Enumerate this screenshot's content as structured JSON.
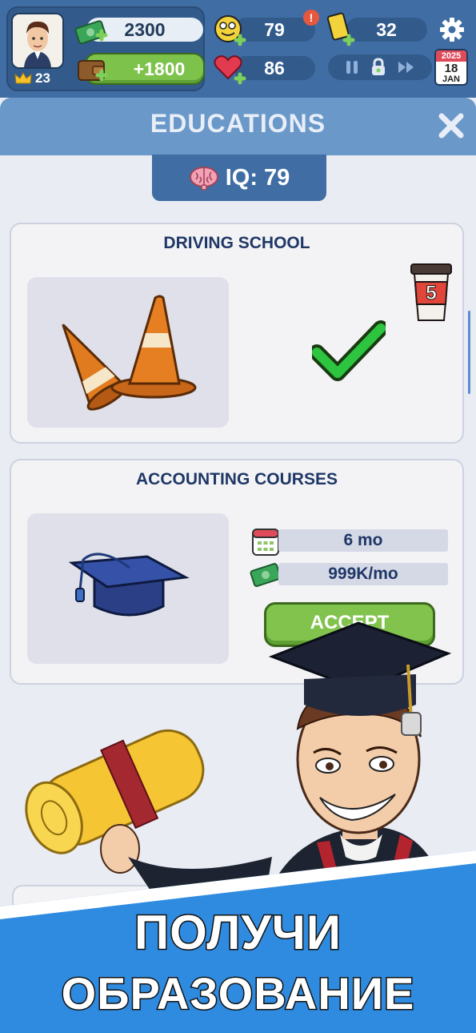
{
  "hud": {
    "level": "23",
    "money": "2300",
    "income": "+1800",
    "happiness": "79",
    "health": "86",
    "energy": "32",
    "calendar": {
      "year": "2025",
      "day": "18",
      "month": "JAN"
    },
    "alert": "!"
  },
  "panel": {
    "title": "EDUCATIONS",
    "iq": "IQ: 79"
  },
  "courses": [
    {
      "title": "DRIVING SCHOOL",
      "status": "completed",
      "badge": "5"
    },
    {
      "title": "ACCOUNTING COURSES",
      "duration": "6 mo",
      "cost": "999K/mo",
      "action": "ACCEPT"
    }
  ],
  "promo": {
    "line1": "ПОЛУЧИ",
    "line2": "ОБРАЗОВАНИЕ"
  },
  "colors": {
    "hud_bg": "#3f6da4",
    "panel_head": "#6a98c9",
    "accept_green": "#82c34e",
    "banner_blue": "#2f8be0",
    "title_navy": "#1f3766"
  }
}
